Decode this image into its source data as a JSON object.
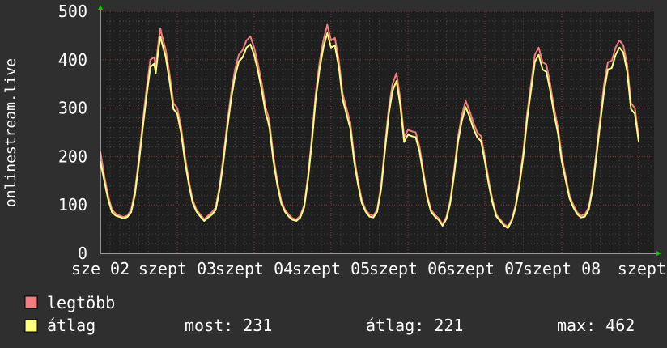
{
  "chart_data": {
    "type": "line",
    "title": "",
    "ylabel": "onlinestream.live",
    "xlabel": "",
    "ylim": [
      0,
      500
    ],
    "yticks": [
      0,
      100,
      200,
      300,
      400,
      500
    ],
    "xlim": [
      0,
      7.2
    ],
    "xtick_labels": [
      "sze 02",
      "szept 03",
      "szept 04",
      "szept 05",
      "szept 06",
      "szept 07",
      "szept 08",
      "szept"
    ],
    "grid": true,
    "legend_position": "bottom-left",
    "series": [
      {
        "name": "legtöbb",
        "color": "#f07f7f",
        "points": [
          [
            0.0,
            210
          ],
          [
            0.05,
            160
          ],
          [
            0.1,
            120
          ],
          [
            0.15,
            90
          ],
          [
            0.2,
            82
          ],
          [
            0.25,
            78
          ],
          [
            0.3,
            75
          ],
          [
            0.35,
            78
          ],
          [
            0.4,
            90
          ],
          [
            0.45,
            130
          ],
          [
            0.5,
            195
          ],
          [
            0.55,
            270
          ],
          [
            0.6,
            340
          ],
          [
            0.65,
            400
          ],
          [
            0.7,
            405
          ],
          [
            0.72,
            385
          ],
          [
            0.75,
            430
          ],
          [
            0.78,
            465
          ],
          [
            0.8,
            450
          ],
          [
            0.85,
            420
          ],
          [
            0.9,
            370
          ],
          [
            0.95,
            310
          ],
          [
            1.0,
            300
          ],
          [
            1.05,
            260
          ],
          [
            1.1,
            200
          ],
          [
            1.15,
            150
          ],
          [
            1.2,
            110
          ],
          [
            1.25,
            90
          ],
          [
            1.3,
            80
          ],
          [
            1.35,
            70
          ],
          [
            1.4,
            78
          ],
          [
            1.45,
            85
          ],
          [
            1.5,
            95
          ],
          [
            1.55,
            140
          ],
          [
            1.6,
            200
          ],
          [
            1.65,
            270
          ],
          [
            1.7,
            330
          ],
          [
            1.75,
            380
          ],
          [
            1.8,
            410
          ],
          [
            1.85,
            420
          ],
          [
            1.9,
            440
          ],
          [
            1.95,
            448
          ],
          [
            2.0,
            425
          ],
          [
            2.05,
            390
          ],
          [
            2.1,
            350
          ],
          [
            2.15,
            300
          ],
          [
            2.18,
            285
          ],
          [
            2.2,
            270
          ],
          [
            2.25,
            200
          ],
          [
            2.3,
            150
          ],
          [
            2.35,
            110
          ],
          [
            2.4,
            90
          ],
          [
            2.45,
            80
          ],
          [
            2.5,
            72
          ],
          [
            2.55,
            70
          ],
          [
            2.6,
            78
          ],
          [
            2.65,
            100
          ],
          [
            2.7,
            160
          ],
          [
            2.75,
            240
          ],
          [
            2.8,
            330
          ],
          [
            2.85,
            395
          ],
          [
            2.9,
            440
          ],
          [
            2.95,
            472
          ],
          [
            3.0,
            440
          ],
          [
            3.05,
            445
          ],
          [
            3.1,
            400
          ],
          [
            3.15,
            330
          ],
          [
            3.2,
            300
          ],
          [
            3.25,
            270
          ],
          [
            3.3,
            200
          ],
          [
            3.35,
            150
          ],
          [
            3.4,
            110
          ],
          [
            3.45,
            90
          ],
          [
            3.5,
            80
          ],
          [
            3.55,
            78
          ],
          [
            3.6,
            90
          ],
          [
            3.65,
            140
          ],
          [
            3.7,
            220
          ],
          [
            3.75,
            300
          ],
          [
            3.8,
            350
          ],
          [
            3.85,
            372
          ],
          [
            3.9,
            320
          ],
          [
            3.95,
            240
          ],
          [
            4.0,
            255
          ],
          [
            4.05,
            252
          ],
          [
            4.1,
            250
          ],
          [
            4.15,
            220
          ],
          [
            4.2,
            170
          ],
          [
            4.25,
            120
          ],
          [
            4.3,
            90
          ],
          [
            4.35,
            80
          ],
          [
            4.4,
            72
          ],
          [
            4.45,
            60
          ],
          [
            4.5,
            75
          ],
          [
            4.55,
            110
          ],
          [
            4.6,
            170
          ],
          [
            4.65,
            240
          ],
          [
            4.7,
            285
          ],
          [
            4.75,
            315
          ],
          [
            4.8,
            295
          ],
          [
            4.85,
            270
          ],
          [
            4.9,
            250
          ],
          [
            4.95,
            242
          ],
          [
            5.0,
            200
          ],
          [
            5.05,
            150
          ],
          [
            5.1,
            110
          ],
          [
            5.15,
            80
          ],
          [
            5.2,
            70
          ],
          [
            5.25,
            60
          ],
          [
            5.3,
            55
          ],
          [
            5.35,
            70
          ],
          [
            5.4,
            100
          ],
          [
            5.45,
            150
          ],
          [
            5.5,
            210
          ],
          [
            5.55,
            290
          ],
          [
            5.6,
            350
          ],
          [
            5.65,
            410
          ],
          [
            5.7,
            425
          ],
          [
            5.75,
            395
          ],
          [
            5.8,
            390
          ],
          [
            5.85,
            350
          ],
          [
            5.9,
            300
          ],
          [
            5.95,
            260
          ],
          [
            6.0,
            200
          ],
          [
            6.05,
            160
          ],
          [
            6.1,
            120
          ],
          [
            6.15,
            100
          ],
          [
            6.2,
            85
          ],
          [
            6.25,
            78
          ],
          [
            6.3,
            80
          ],
          [
            6.35,
            95
          ],
          [
            6.4,
            140
          ],
          [
            6.45,
            210
          ],
          [
            6.5,
            280
          ],
          [
            6.55,
            350
          ],
          [
            6.6,
            395
          ],
          [
            6.65,
            398
          ],
          [
            6.7,
            425
          ],
          [
            6.75,
            440
          ],
          [
            6.8,
            430
          ],
          [
            6.85,
            390
          ],
          [
            6.9,
            310
          ],
          [
            6.95,
            300
          ],
          [
            7.0,
            240
          ]
        ]
      },
      {
        "name": "átlag",
        "color": "#ffff80",
        "points": [
          [
            0.0,
            190
          ],
          [
            0.05,
            150
          ],
          [
            0.1,
            112
          ],
          [
            0.15,
            85
          ],
          [
            0.2,
            78
          ],
          [
            0.25,
            75
          ],
          [
            0.3,
            72
          ],
          [
            0.35,
            75
          ],
          [
            0.4,
            85
          ],
          [
            0.45,
            122
          ],
          [
            0.5,
            185
          ],
          [
            0.55,
            258
          ],
          [
            0.6,
            325
          ],
          [
            0.65,
            385
          ],
          [
            0.7,
            392
          ],
          [
            0.72,
            372
          ],
          [
            0.75,
            415
          ],
          [
            0.78,
            448
          ],
          [
            0.8,
            435
          ],
          [
            0.85,
            405
          ],
          [
            0.9,
            355
          ],
          [
            0.95,
            298
          ],
          [
            1.0,
            288
          ],
          [
            1.05,
            248
          ],
          [
            1.1,
            190
          ],
          [
            1.15,
            142
          ],
          [
            1.2,
            104
          ],
          [
            1.25,
            86
          ],
          [
            1.3,
            76
          ],
          [
            1.35,
            67
          ],
          [
            1.4,
            74
          ],
          [
            1.45,
            80
          ],
          [
            1.5,
            90
          ],
          [
            1.55,
            132
          ],
          [
            1.6,
            190
          ],
          [
            1.65,
            258
          ],
          [
            1.7,
            318
          ],
          [
            1.75,
            366
          ],
          [
            1.8,
            396
          ],
          [
            1.85,
            405
          ],
          [
            1.9,
            425
          ],
          [
            1.95,
            432
          ],
          [
            2.0,
            410
          ],
          [
            2.05,
            376
          ],
          [
            2.1,
            336
          ],
          [
            2.15,
            288
          ],
          [
            2.18,
            273
          ],
          [
            2.2,
            258
          ],
          [
            2.25,
            190
          ],
          [
            2.3,
            142
          ],
          [
            2.35,
            104
          ],
          [
            2.4,
            86
          ],
          [
            2.45,
            76
          ],
          [
            2.5,
            69
          ],
          [
            2.55,
            67
          ],
          [
            2.6,
            74
          ],
          [
            2.65,
            95
          ],
          [
            2.7,
            152
          ],
          [
            2.75,
            230
          ],
          [
            2.8,
            318
          ],
          [
            2.85,
            380
          ],
          [
            2.9,
            425
          ],
          [
            2.95,
            455
          ],
          [
            3.0,
            425
          ],
          [
            3.05,
            430
          ],
          [
            3.1,
            386
          ],
          [
            3.15,
            318
          ],
          [
            3.2,
            288
          ],
          [
            3.25,
            258
          ],
          [
            3.3,
            190
          ],
          [
            3.35,
            142
          ],
          [
            3.4,
            104
          ],
          [
            3.45,
            86
          ],
          [
            3.5,
            76
          ],
          [
            3.55,
            74
          ],
          [
            3.6,
            86
          ],
          [
            3.65,
            132
          ],
          [
            3.7,
            210
          ],
          [
            3.75,
            288
          ],
          [
            3.8,
            336
          ],
          [
            3.85,
            356
          ],
          [
            3.9,
            306
          ],
          [
            3.95,
            230
          ],
          [
            4.0,
            245
          ],
          [
            4.05,
            242
          ],
          [
            4.1,
            240
          ],
          [
            4.15,
            210
          ],
          [
            4.2,
            162
          ],
          [
            4.25,
            114
          ],
          [
            4.3,
            86
          ],
          [
            4.35,
            76
          ],
          [
            4.4,
            69
          ],
          [
            4.45,
            57
          ],
          [
            4.5,
            71
          ],
          [
            4.55,
            104
          ],
          [
            4.6,
            162
          ],
          [
            4.65,
            230
          ],
          [
            4.7,
            273
          ],
          [
            4.75,
            302
          ],
          [
            4.8,
            283
          ],
          [
            4.85,
            258
          ],
          [
            4.9,
            240
          ],
          [
            4.95,
            232
          ],
          [
            5.0,
            190
          ],
          [
            5.05,
            142
          ],
          [
            5.1,
            104
          ],
          [
            5.15,
            76
          ],
          [
            5.2,
            67
          ],
          [
            5.25,
            57
          ],
          [
            5.3,
            52
          ],
          [
            5.35,
            67
          ],
          [
            5.4,
            95
          ],
          [
            5.45,
            142
          ],
          [
            5.5,
            200
          ],
          [
            5.55,
            278
          ],
          [
            5.6,
            336
          ],
          [
            5.65,
            396
          ],
          [
            5.7,
            410
          ],
          [
            5.75,
            380
          ],
          [
            5.8,
            375
          ],
          [
            5.85,
            336
          ],
          [
            5.9,
            288
          ],
          [
            5.95,
            248
          ],
          [
            6.0,
            190
          ],
          [
            6.05,
            152
          ],
          [
            6.1,
            114
          ],
          [
            6.15,
            95
          ],
          [
            6.2,
            81
          ],
          [
            6.25,
            74
          ],
          [
            6.3,
            76
          ],
          [
            6.35,
            90
          ],
          [
            6.4,
            132
          ],
          [
            6.45,
            200
          ],
          [
            6.5,
            268
          ],
          [
            6.55,
            336
          ],
          [
            6.6,
            380
          ],
          [
            6.65,
            383
          ],
          [
            6.7,
            410
          ],
          [
            6.75,
            425
          ],
          [
            6.8,
            415
          ],
          [
            6.85,
            376
          ],
          [
            6.9,
            298
          ],
          [
            6.95,
            288
          ],
          [
            7.0,
            231
          ]
        ]
      }
    ]
  },
  "legend": [
    {
      "label": "legtöbb",
      "color": "#f07f7f"
    },
    {
      "label": "átlag",
      "color": "#ffff80"
    }
  ],
  "stats": {
    "now": "most: 231",
    "avg": "átlag: 221",
    "max": "max: 462"
  }
}
